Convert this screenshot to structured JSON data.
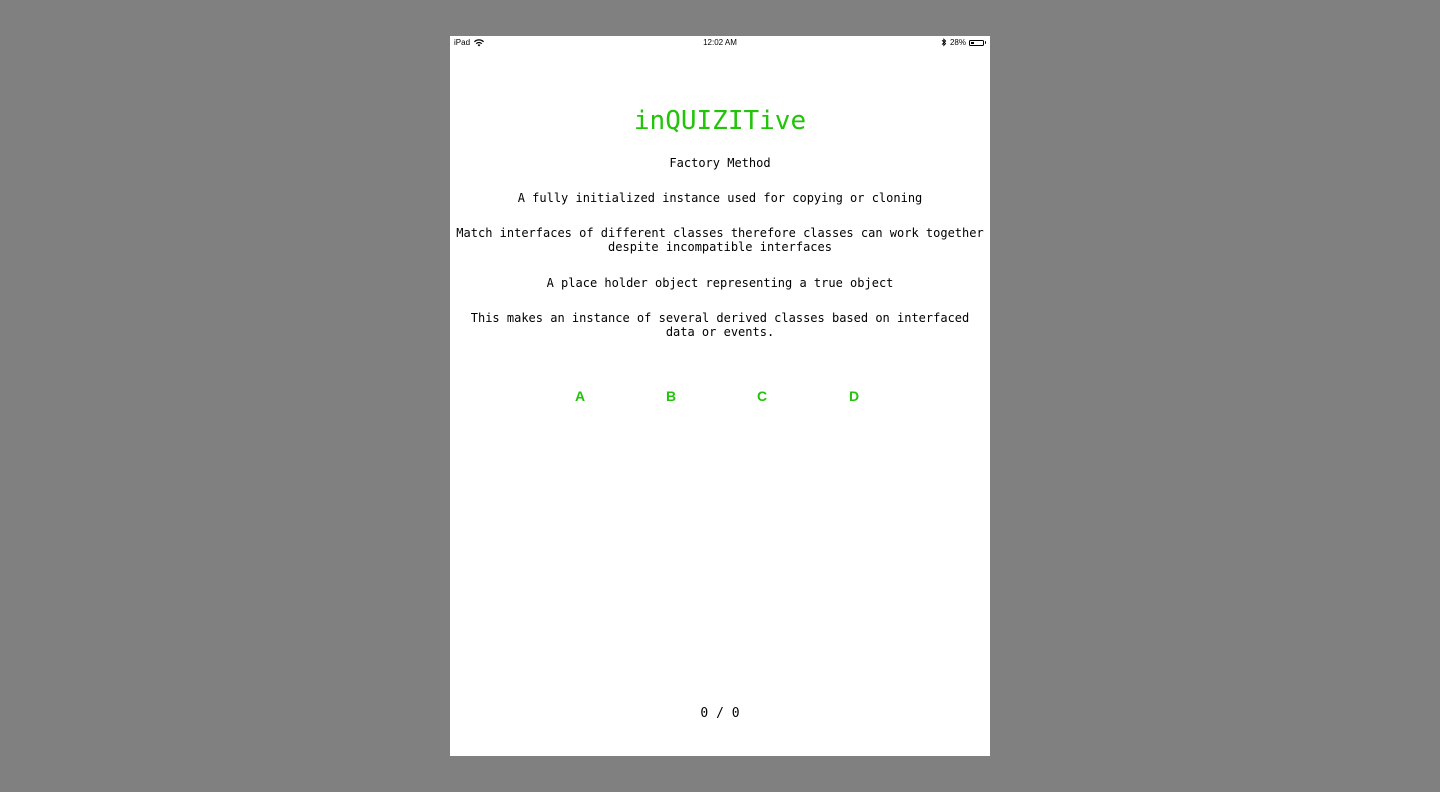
{
  "status_bar": {
    "device": "iPad",
    "time": "12:02 AM",
    "battery_percent": "28%",
    "battery_level": 0.28,
    "icons": [
      "wifi-icon",
      "bluetooth-icon",
      "battery-icon"
    ]
  },
  "app": {
    "title": "inQUIZITive",
    "accent_color": "#22c40a"
  },
  "quiz": {
    "question": "Factory Method",
    "options": [
      "A fully initialized instance used for copying or cloning",
      "Match interfaces of different classes therefore classes can work together despite incompatible interfaces",
      "A place holder object representing a true object",
      "This makes an instance of several derived classes based on interfaced data or events."
    ],
    "answer_labels": [
      "A",
      "B",
      "C",
      "D"
    ],
    "score": "0 / 0"
  }
}
